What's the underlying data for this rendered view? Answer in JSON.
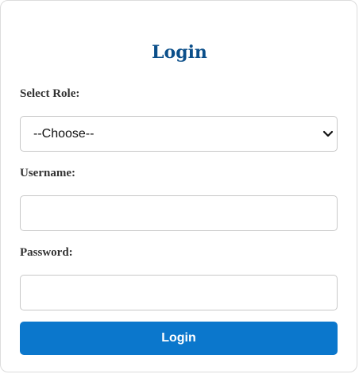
{
  "form": {
    "title": "Login",
    "role_label": "Select Role:",
    "role_selected": "--Choose--",
    "username_label": "Username:",
    "username_value": "",
    "password_label": "Password:",
    "password_value": "",
    "submit_label": "Login"
  },
  "icons": {
    "select_arrow": "chevron-down-icon"
  },
  "colors": {
    "title": "#0b4f8a",
    "button": "#0b77cc",
    "button_text": "#ffffff"
  }
}
